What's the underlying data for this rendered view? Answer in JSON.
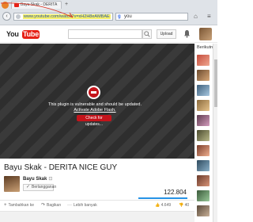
{
  "browser": {
    "tab_title": "Bayu Skak - DERITA",
    "url": "www.youtube.com/watch?v=xH2H8eAMBAE",
    "search_query": "you"
  },
  "masthead": {
    "logo_you": "You",
    "logo_tube": "Tube",
    "upload_label": "Upload"
  },
  "player": {
    "message": "This plugin is vulnerable and should be updated.",
    "activate_link": "Activate Adobe Flash.",
    "check_button": "Check for updates..."
  },
  "sidebar": {
    "title": "Berikutnya"
  },
  "video": {
    "title": "Bayu Skak - DERITA NICE GUY",
    "channel": "Bayu Skak",
    "subscribe_label": "Berlangganan",
    "views": "122.804"
  },
  "actions": {
    "add_to": "Tambahkan ke",
    "share": "Bagikan",
    "more": "Lebih banyak",
    "likes": "4.649",
    "dislikes": "40"
  },
  "colors": {
    "youtube_red": "#e62117",
    "flash_red": "#c4141b",
    "view_bar": "#2793e6",
    "url_highlight": "#f5f06a"
  }
}
